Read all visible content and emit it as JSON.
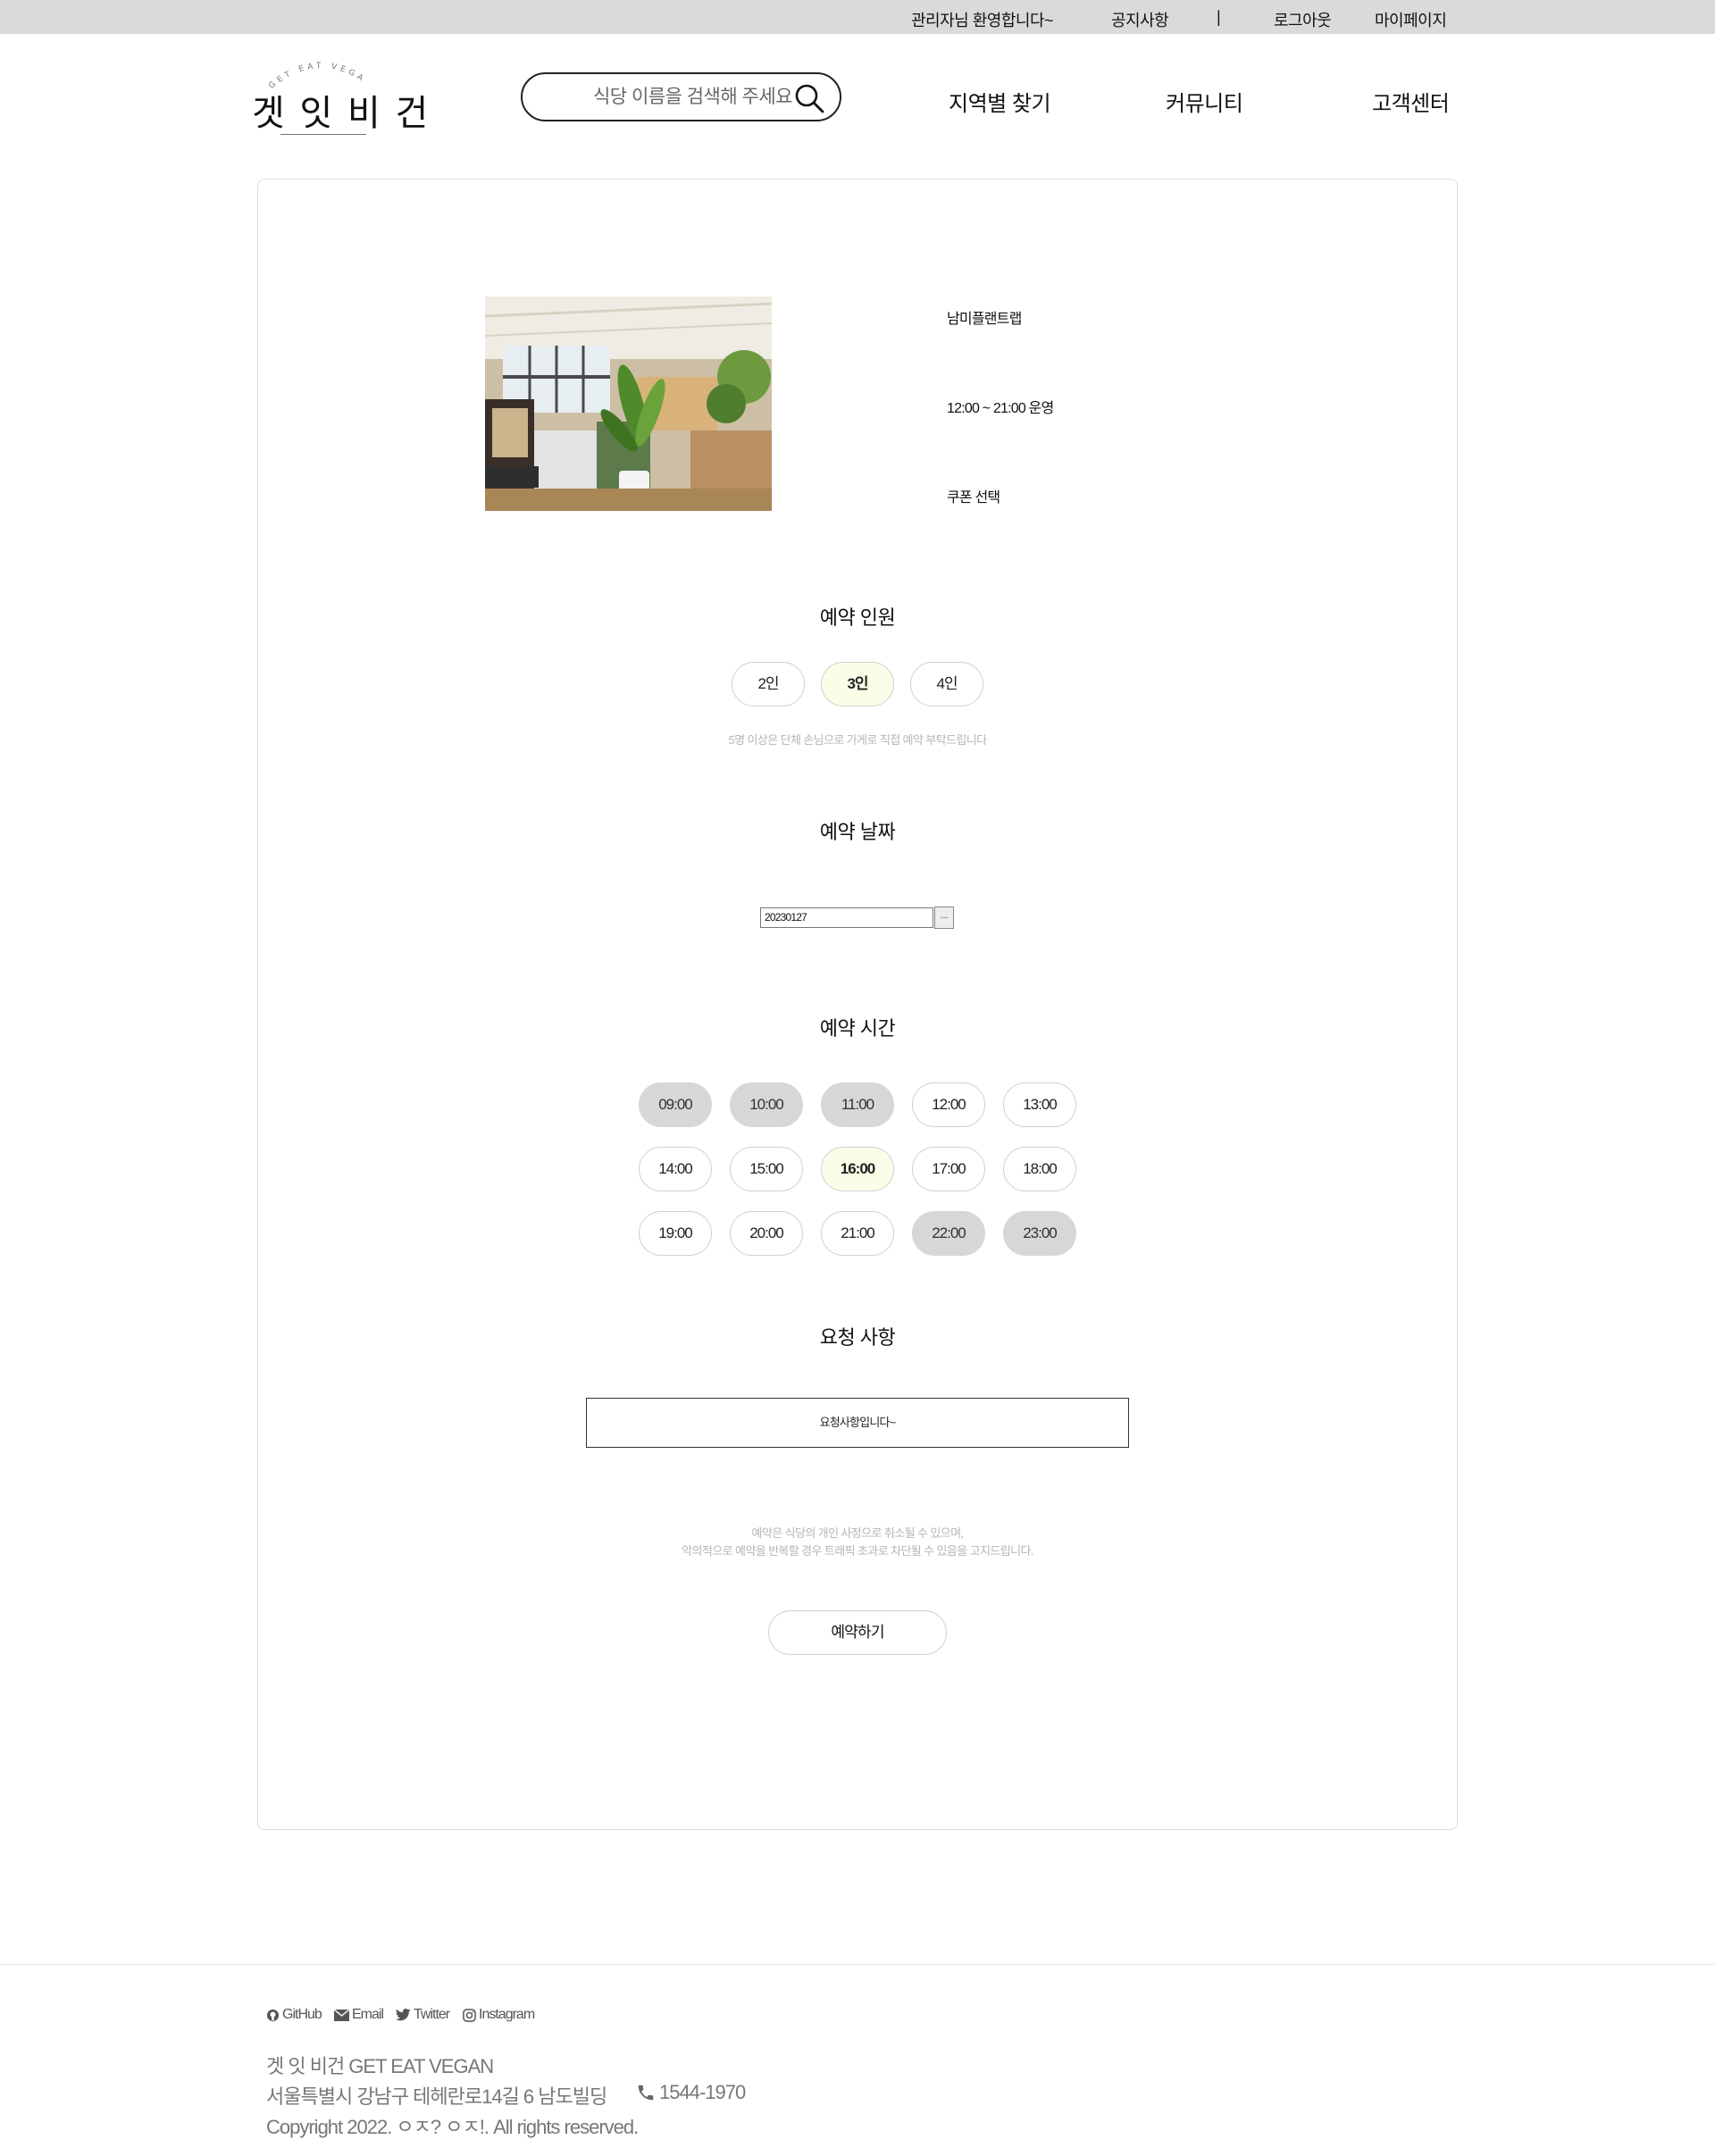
{
  "topbar": {
    "welcome": "관리자님 환영합니다~",
    "notice": "공지사항",
    "divider": "|",
    "logout": "로그아웃",
    "mypage": "마이페이지"
  },
  "header": {
    "logo_sub": "GET EAT VEGAN",
    "logo_main": "겟 잇 비 건",
    "search_placeholder": "식당 이름을 검색해 주세요",
    "nav": [
      "지역별 찾기",
      "커뮤니티",
      "고객센터"
    ]
  },
  "restaurant": {
    "name": "남미플랜트랩",
    "hours": "12:00 ~ 21:00 운영",
    "coupon": "쿠폰 선택"
  },
  "party": {
    "title": "예약 인원",
    "options": [
      {
        "label": "2인",
        "state": "normal"
      },
      {
        "label": "3인",
        "state": "selected"
      },
      {
        "label": "4인",
        "state": "normal"
      }
    ],
    "note": "5명 이상은 단체 손님으로 가게로 직접 예약 부탁드립니다"
  },
  "date": {
    "title": "예약 날짜",
    "value": "20230127",
    "button": "..."
  },
  "time": {
    "title": "예약 시간",
    "slots": [
      {
        "label": "09:00",
        "state": "disabled"
      },
      {
        "label": "10:00",
        "state": "disabled"
      },
      {
        "label": "11:00",
        "state": "disabled"
      },
      {
        "label": "12:00",
        "state": "normal"
      },
      {
        "label": "13:00",
        "state": "normal"
      },
      {
        "label": "14:00",
        "state": "normal"
      },
      {
        "label": "15:00",
        "state": "normal"
      },
      {
        "label": "16:00",
        "state": "selected"
      },
      {
        "label": "17:00",
        "state": "normal"
      },
      {
        "label": "18:00",
        "state": "normal"
      },
      {
        "label": "19:00",
        "state": "normal"
      },
      {
        "label": "20:00",
        "state": "normal"
      },
      {
        "label": "21:00",
        "state": "normal"
      },
      {
        "label": "22:00",
        "state": "disabled"
      },
      {
        "label": "23:00",
        "state": "disabled"
      }
    ]
  },
  "request": {
    "title": "요청 사항",
    "value": "요청사항입니다~"
  },
  "notice": {
    "line1": "예약은 식당의 개인 사정으로 취소될 수 있으며,",
    "line2": "악의적으로 예약을 반복할 경우 트래픽 초과로 차단될 수 있음을 고지드립니다."
  },
  "submit_label": "예약하기",
  "footer": {
    "github": "GitHub",
    "email": "Email",
    "twitter": "Twitter",
    "instagram": "Instagram",
    "brand": "겟 잇 비건 GET EAT VEGAN",
    "address": "서울특별시 강남구 테헤란로14길 6 남도빌딩",
    "phone": "1544-1970",
    "copyright": "Copyright 2022. ㅇㅈ? ㅇㅈ!. All rights reserved."
  }
}
